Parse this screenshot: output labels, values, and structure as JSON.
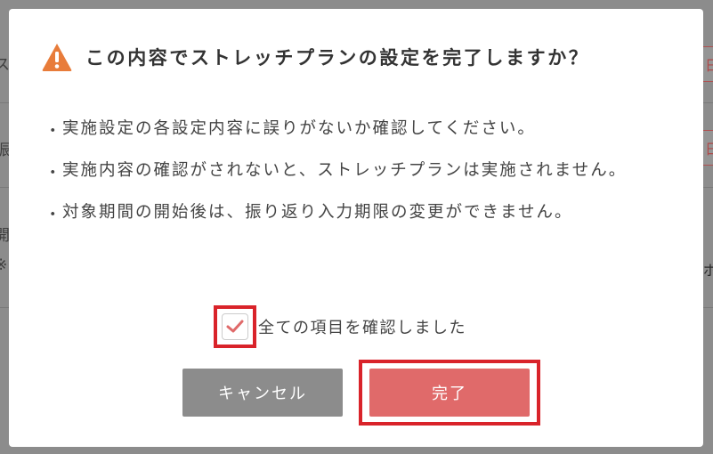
{
  "background": {
    "left_chars": [
      "ス",
      "振",
      "開",
      "※"
    ],
    "right_chars": [
      "日",
      "日",
      "ボ"
    ]
  },
  "dialog": {
    "icon": "warning-triangle-icon",
    "title": "この内容でストレッチプランの設定を完了しますか？",
    "bullet_marker": "・",
    "bullets": [
      "実施設定の各設定内容に誤りがないか確認してください。",
      "実施内容の確認がされないと、ストレッチプランは実施されません。",
      "対象期間の開始後は、振り返り入力期限の変更ができません。"
    ],
    "confirm": {
      "label": "全ての項目を確認しました",
      "checked": true
    },
    "cancel_label": "キャンセル",
    "done_label": "完了"
  },
  "colors": {
    "warning": "#e87c3a",
    "primary": "#e06a6a",
    "cancel": "#8c8c8c",
    "highlight": "#d9232a"
  }
}
